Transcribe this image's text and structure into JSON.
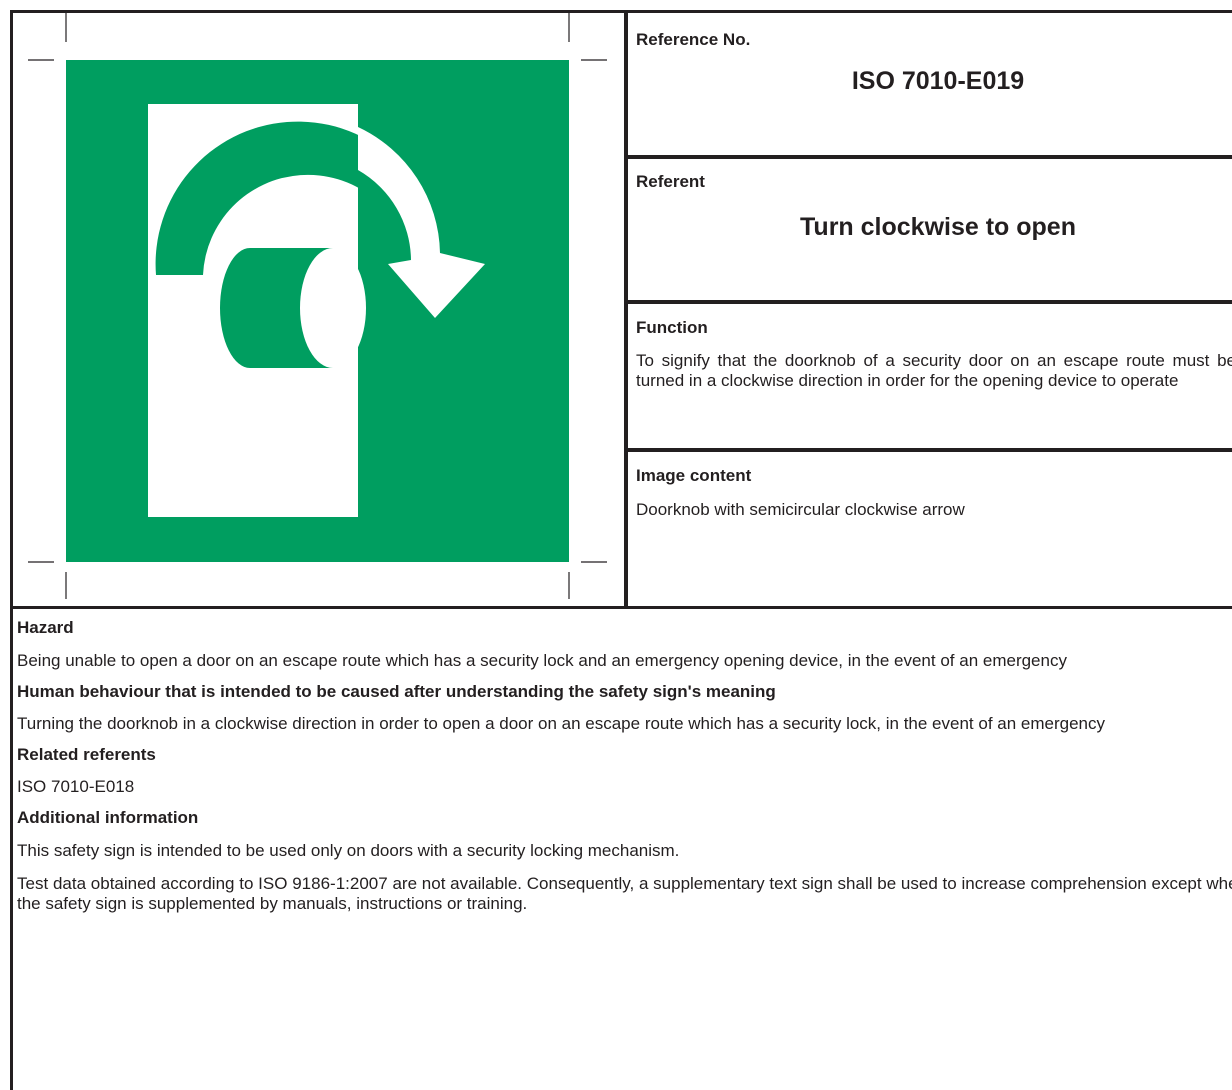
{
  "colors": {
    "sign_green": "#009e60",
    "ink": "#231f20",
    "white": "#ffffff"
  },
  "sign": {
    "icon": "turn-clockwise-doorknob-icon"
  },
  "reference": {
    "label": "Reference No.",
    "value": "ISO 7010-E019"
  },
  "referent": {
    "label": "Referent",
    "value": "Turn clockwise to open"
  },
  "function": {
    "label": "Function",
    "text": "To signify that the doorknob of a security door on an escape route must be turned in a clockwise direction in order for the opening device to operate"
  },
  "image_content": {
    "label": "Image content",
    "text": "Doorknob with semicircular clockwise arrow"
  },
  "hazard": {
    "label": "Hazard",
    "text": "Being unable to open a door on an escape route which has a security lock and an emergency opening device, in the event of an emergency"
  },
  "behaviour": {
    "label": "Human behaviour that is intended to be caused after understanding the safety sign's meaning",
    "text": "Turning the doorknob in a clockwise direction in order to open a door on an escape route which has a security lock, in the event of an emergency"
  },
  "related": {
    "label": "Related referents",
    "text": "ISO 7010-E018"
  },
  "additional": {
    "label": "Additional information",
    "text1": "This safety sign is intended to be used only on doors with a security locking mechanism.",
    "text2": "Test data obtained according to ISO 9186-1:2007 are not available. Consequently, a supplementary text sign shall be used to increase comprehension except when the safety sign is supplemented by manuals, instructions or training."
  }
}
